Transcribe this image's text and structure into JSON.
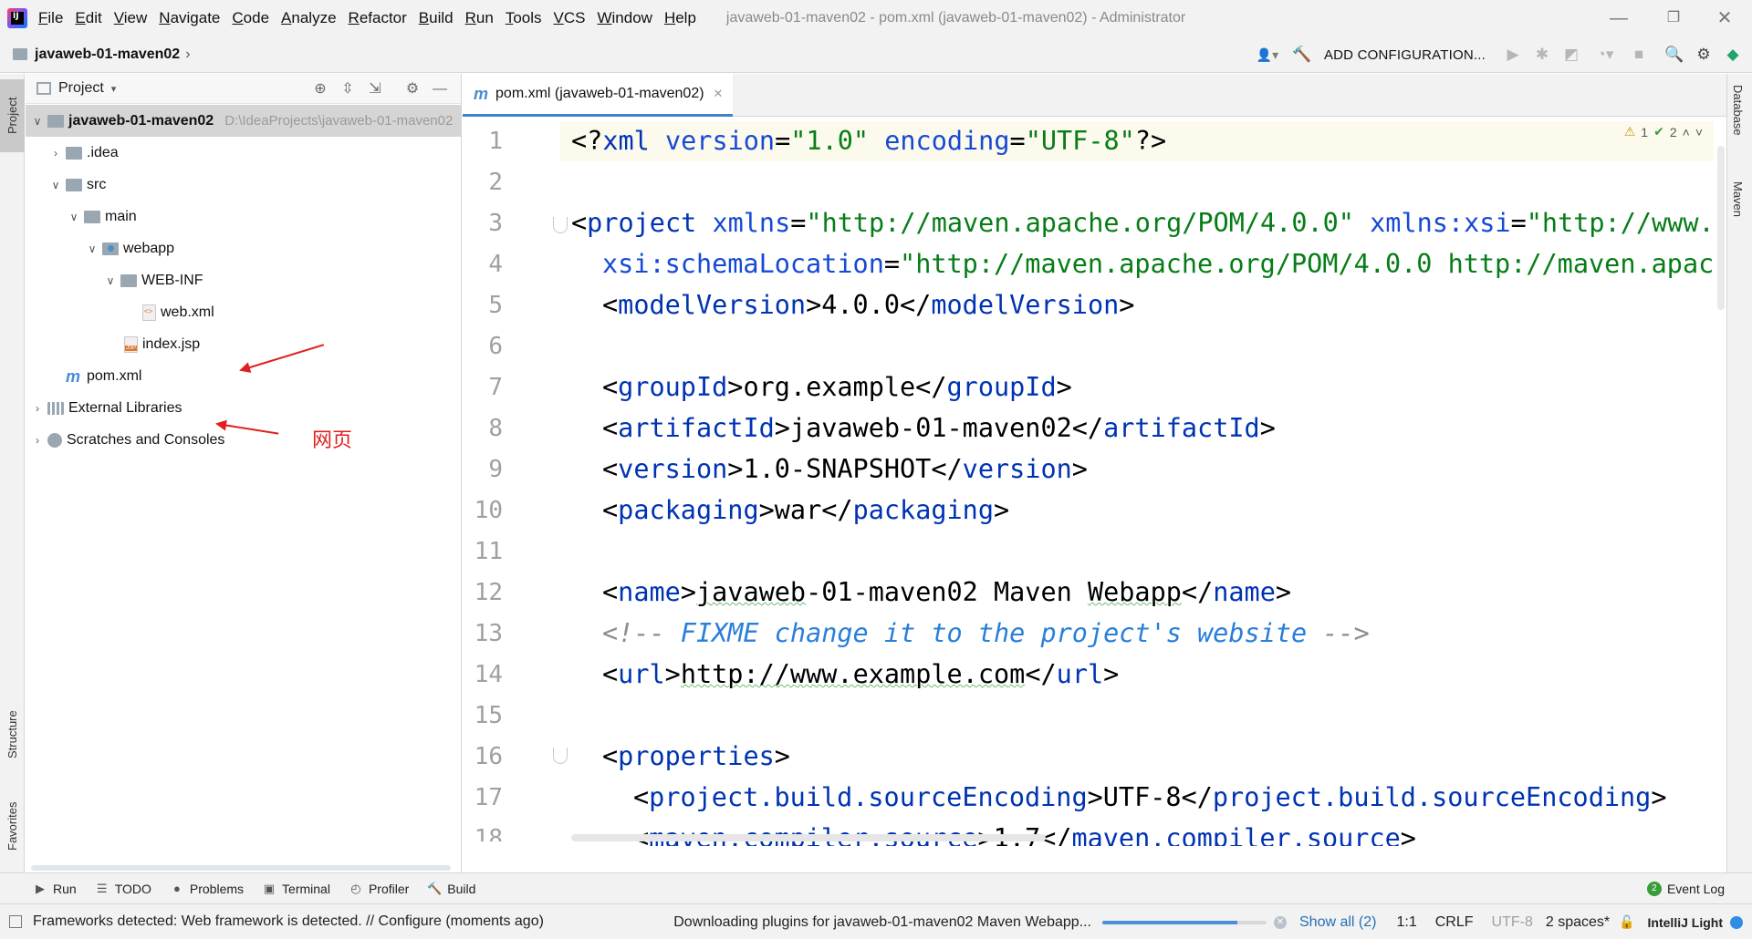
{
  "menubar": {
    "app_logo_text": "IJ",
    "items": [
      {
        "label": "File",
        "mnemonic": "F",
        "rest": "ile"
      },
      {
        "label": "Edit",
        "mnemonic": "E",
        "rest": "dit"
      },
      {
        "label": "View",
        "mnemonic": "V",
        "rest": "iew"
      },
      {
        "label": "Navigate",
        "mnemonic": "N",
        "rest": "avigate"
      },
      {
        "label": "Code",
        "mnemonic": "C",
        "rest": "ode"
      },
      {
        "label": "Analyze",
        "mnemonic": "A",
        "rest": "nalyze"
      },
      {
        "label": "Refactor",
        "mnemonic": "R",
        "rest": "efactor"
      },
      {
        "label": "Build",
        "mnemonic": "B",
        "rest": "uild"
      },
      {
        "label": "Run",
        "mnemonic": "R",
        "rest": "un"
      },
      {
        "label": "Tools",
        "mnemonic": "T",
        "rest": "ools"
      },
      {
        "label": "VCS",
        "mnemonic": "V",
        "rest": "CS"
      },
      {
        "label": "Window",
        "mnemonic": "W",
        "rest": "indow"
      },
      {
        "label": "Help",
        "mnemonic": "H",
        "rest": "elp"
      }
    ],
    "window_title": "javaweb-01-maven02 - pom.xml (javaweb-01-maven02) - Administrator",
    "minimize": "—",
    "restore": "❐",
    "close": "✕"
  },
  "navbar": {
    "breadcrumb": "javaweb-01-maven02",
    "chevron": "›",
    "add_configuration": "ADD CONFIGURATION...",
    "icons": {
      "user": "👤▾",
      "build": "🔨",
      "run": "▶",
      "debug": "✱",
      "coverage": "◩",
      "profile": "◔▾",
      "stop": "■",
      "search": "🔍",
      "settings": "⚙",
      "plugin": "◆"
    }
  },
  "left_strip": {
    "project_tab": "Project",
    "structure_tab": "Structure",
    "favorites_tab": "Favorites"
  },
  "project_panel": {
    "title": "Project",
    "dropdown": "▾",
    "icons": {
      "locate": "⊕",
      "expand": "⇳",
      "collapse": "⇲",
      "settings": "⚙",
      "hide": "—"
    },
    "tree": [
      {
        "label": "javaweb-01-maven02",
        "path": "D:\\IdeaProjects\\javaweb-01-maven02",
        "toggle": "∨"
      },
      {
        "label": ".idea",
        "toggle": "›"
      },
      {
        "label": "src",
        "toggle": "∨"
      },
      {
        "label": "main",
        "toggle": "∨"
      },
      {
        "label": "webapp",
        "toggle": "∨"
      },
      {
        "label": "WEB-INF",
        "toggle": "∨"
      },
      {
        "label": "web.xml",
        "toggle": ""
      },
      {
        "label": "index.jsp",
        "toggle": ""
      },
      {
        "label": "pom.xml",
        "toggle": "",
        "icon_text": "m"
      },
      {
        "label": "External Libraries",
        "toggle": "›"
      },
      {
        "label": "Scratches and Consoles",
        "toggle": "›"
      }
    ],
    "annotation": "网页"
  },
  "editor": {
    "tab": {
      "icon_text": "m",
      "label": "pom.xml (javaweb-01-maven02)",
      "close": "✕"
    },
    "inspections": {
      "warn_icon": "⚠",
      "warnings": "1",
      "ok_icon": "✔",
      "weak_warnings": "2",
      "up": "˄",
      "down": "˅"
    },
    "line_numbers": [
      "1",
      "2",
      "3",
      "4",
      "5",
      "6",
      "7",
      "8",
      "9",
      "10",
      "11",
      "12",
      "13",
      "14",
      "15",
      "16",
      "17",
      "18"
    ]
  },
  "right_strip": {
    "database_tab": "Database",
    "maven_tab": "Maven"
  },
  "bottom_bar": {
    "run": "Run",
    "todo": "TODO",
    "problems": "Problems",
    "terminal": "Terminal",
    "profiler": "Profiler",
    "build": "Build",
    "event_log": "Event Log",
    "event_badge": "2",
    "icons": {
      "run": "▶",
      "todo": "☰",
      "problems": "●",
      "terminal": "▣",
      "profiler": "◴",
      "build": "🔨"
    }
  },
  "statusbar": {
    "message": "Frameworks detected: Web framework is detected. // Configure (moments ago)",
    "progress_text": "Downloading plugins for javaweb-01-maven02 Maven Webapp...",
    "progress_fraction": 0.82,
    "cancel": "✕",
    "show_all": "Show all (2)",
    "position": "1:1",
    "line_sep": "CRLF",
    "encoding": "UTF-8",
    "indent": "2 spaces*",
    "lock": "🔓",
    "theme": "IntelliJ Light"
  },
  "colors": {
    "tag": "#0033b3",
    "attr": "#174ad4",
    "string": "#067d17",
    "comment_text": "#2a7fd9",
    "annotation_red": "#e02020",
    "progress": "#4a90d9"
  }
}
